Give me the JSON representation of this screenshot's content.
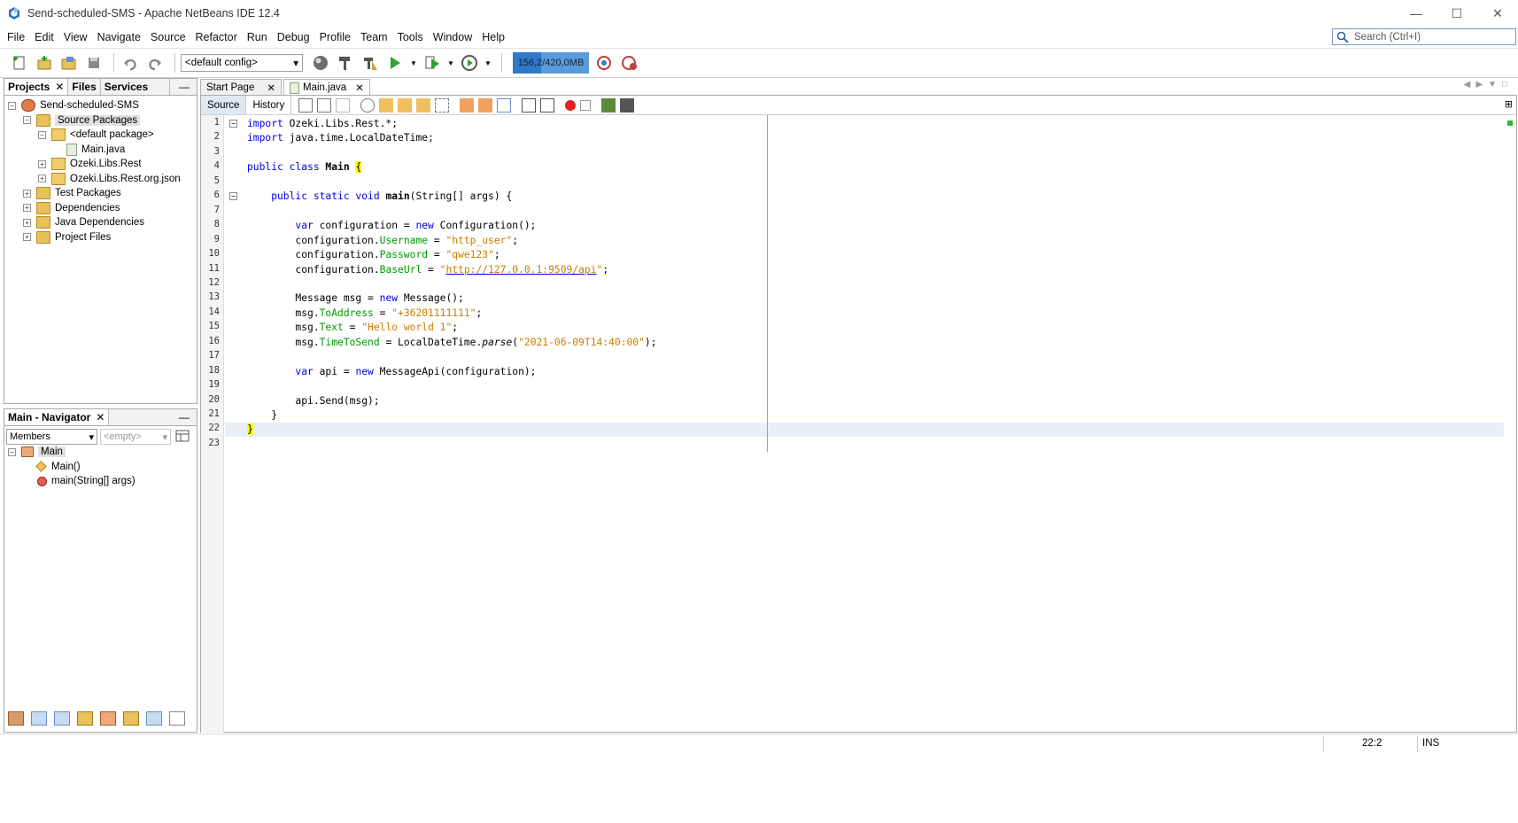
{
  "window": {
    "title": "Send-scheduled-SMS - Apache NetBeans IDE 12.4"
  },
  "menu": [
    "File",
    "Edit",
    "View",
    "Navigate",
    "Source",
    "Refactor",
    "Run",
    "Debug",
    "Profile",
    "Team",
    "Tools",
    "Window",
    "Help"
  ],
  "search": {
    "placeholder": "Search (Ctrl+I)"
  },
  "toolbar": {
    "config": "<default config>",
    "memory": "156,2/420,0MB",
    "memory_fraction": 0.37
  },
  "projects_panel": {
    "tabs": [
      "Projects",
      "Files",
      "Services"
    ],
    "tree": [
      {
        "label": "Send-scheduled-SMS",
        "level": 0,
        "expander": "−",
        "icon": "project-icon"
      },
      {
        "label": "Source Packages",
        "level": 1,
        "expander": "−",
        "icon": "folder-icon",
        "selected": true
      },
      {
        "label": "<default package>",
        "level": 2,
        "expander": "−",
        "icon": "package-icon"
      },
      {
        "label": "Main.java",
        "level": 3,
        "expander": "",
        "icon": "java-file-icon"
      },
      {
        "label": "Ozeki.Libs.Rest",
        "level": 2,
        "expander": "+",
        "icon": "package-icon"
      },
      {
        "label": "Ozeki.Libs.Rest.org.json",
        "level": 2,
        "expander": "+",
        "icon": "package-icon"
      },
      {
        "label": "Test Packages",
        "level": 1,
        "expander": "+",
        "icon": "folder-icon"
      },
      {
        "label": "Dependencies",
        "level": 1,
        "expander": "+",
        "icon": "folder-icon"
      },
      {
        "label": "Java Dependencies",
        "level": 1,
        "expander": "+",
        "icon": "folder-icon"
      },
      {
        "label": "Project Files",
        "level": 1,
        "expander": "+",
        "icon": "folder-icon"
      }
    ]
  },
  "navigator_panel": {
    "title": "Main - Navigator",
    "filter": "Members",
    "filter2": "<empty>",
    "tree": [
      {
        "label": "Main",
        "level": 0,
        "expander": "−"
      },
      {
        "label": "Main()",
        "level": 1
      },
      {
        "label": "main(String[] args)",
        "level": 1
      }
    ]
  },
  "editor": {
    "tabs": [
      "Start Page",
      "Main.java"
    ],
    "mode_tabs": [
      "Source",
      "History"
    ],
    "code_lines": [
      [
        {
          "t": "import",
          "c": "kw"
        },
        {
          "t": " Ozeki.Libs.Rest.*;"
        }
      ],
      [
        {
          "t": "import",
          "c": "kw"
        },
        {
          "t": " java.time.LocalDateTime;"
        }
      ],
      [],
      [
        {
          "t": "public class ",
          "c": "kw"
        },
        {
          "t": "Main",
          "c": "cls"
        },
        {
          "t": " "
        },
        {
          "t": "{",
          "c": "brace-hl"
        }
      ],
      [],
      [
        {
          "t": "    public static void ",
          "c": "kw"
        },
        {
          "t": "main",
          "c": "mth"
        },
        {
          "t": "(String[] args) {"
        }
      ],
      [],
      [
        {
          "t": "        "
        },
        {
          "t": "var",
          "c": "kw"
        },
        {
          "t": " configuration = "
        },
        {
          "t": "new",
          "c": "kw"
        },
        {
          "t": " Configuration();"
        }
      ],
      [
        {
          "t": "        configuration."
        },
        {
          "t": "Username",
          "c": "fld"
        },
        {
          "t": " = "
        },
        {
          "t": "\"http_user\"",
          "c": "str"
        },
        {
          "t": ";"
        }
      ],
      [
        {
          "t": "        configuration."
        },
        {
          "t": "Password",
          "c": "fld"
        },
        {
          "t": " = "
        },
        {
          "t": "\"qwe123\"",
          "c": "str"
        },
        {
          "t": ";"
        }
      ],
      [
        {
          "t": "        configuration."
        },
        {
          "t": "BaseUrl",
          "c": "fld"
        },
        {
          "t": " = "
        },
        {
          "t": "\"",
          "c": "str"
        },
        {
          "t": "http://127.0.0.1:9509/api",
          "c": "url"
        },
        {
          "t": "\"",
          "c": "str"
        },
        {
          "t": ";"
        }
      ],
      [],
      [
        {
          "t": "        Message msg = "
        },
        {
          "t": "new",
          "c": "kw"
        },
        {
          "t": " Message();"
        }
      ],
      [
        {
          "t": "        msg."
        },
        {
          "t": "ToAddress",
          "c": "fld"
        },
        {
          "t": " = "
        },
        {
          "t": "\"+36201111111\"",
          "c": "str"
        },
        {
          "t": ";"
        }
      ],
      [
        {
          "t": "        msg."
        },
        {
          "t": "Text",
          "c": "fld"
        },
        {
          "t": " = "
        },
        {
          "t": "\"Hello world 1\"",
          "c": "str"
        },
        {
          "t": ";"
        }
      ],
      [
        {
          "t": "        msg."
        },
        {
          "t": "TimeToSend",
          "c": "fld"
        },
        {
          "t": " = LocalDateTime."
        },
        {
          "t": "parse",
          "c": "italic"
        },
        {
          "t": "("
        },
        {
          "t": "\"2021-06-09T14:40:00\"",
          "c": "str"
        },
        {
          "t": ");"
        }
      ],
      [],
      [
        {
          "t": "        "
        },
        {
          "t": "var",
          "c": "kw"
        },
        {
          "t": " api = "
        },
        {
          "t": "new",
          "c": "kw"
        },
        {
          "t": " MessageApi(configuration);"
        }
      ],
      [],
      [
        {
          "t": "        api.Send(msg);"
        }
      ],
      [
        {
          "t": "    }"
        }
      ],
      [
        {
          "t": "}",
          "c": "brace-hl"
        }
      ],
      []
    ],
    "current_line": 22
  },
  "status": {
    "position": "22:2",
    "mode": "INS"
  }
}
